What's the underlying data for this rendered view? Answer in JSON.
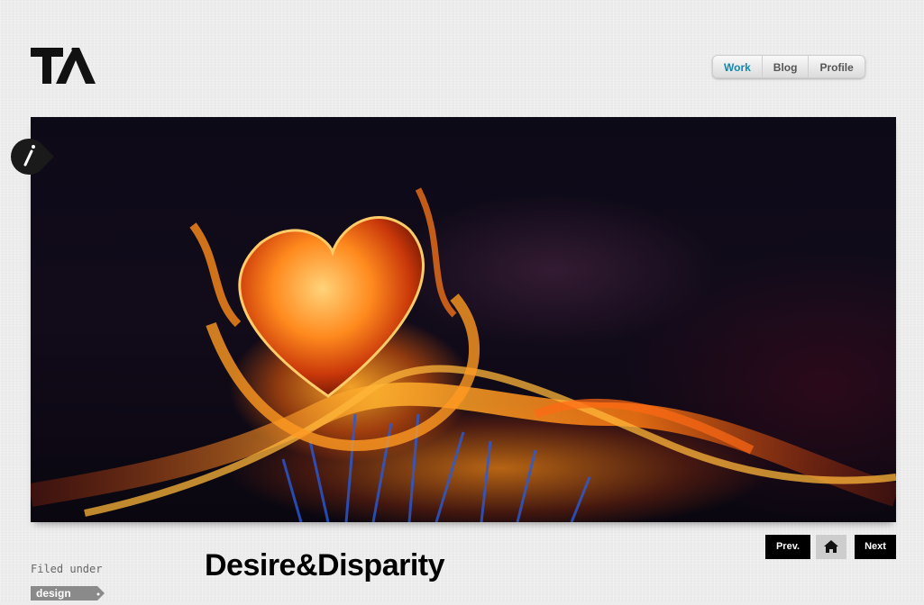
{
  "header": {
    "logo_icon": "ta-monogram-logo",
    "nav": [
      {
        "label": "Work",
        "active": true
      },
      {
        "label": "Blog",
        "active": false
      },
      {
        "label": "Profile",
        "active": false
      }
    ],
    "active_color": "#0e89b0"
  },
  "hero": {
    "image": "fiery-heart-artwork",
    "info_icon": "info-icon"
  },
  "pager": {
    "prev_label": "Prev.",
    "home_icon": "home-icon",
    "next_label": "Next"
  },
  "meta": {
    "filed_under_label": "Filed under",
    "tag": "design"
  },
  "project": {
    "title": "Desire&Disparity"
  }
}
